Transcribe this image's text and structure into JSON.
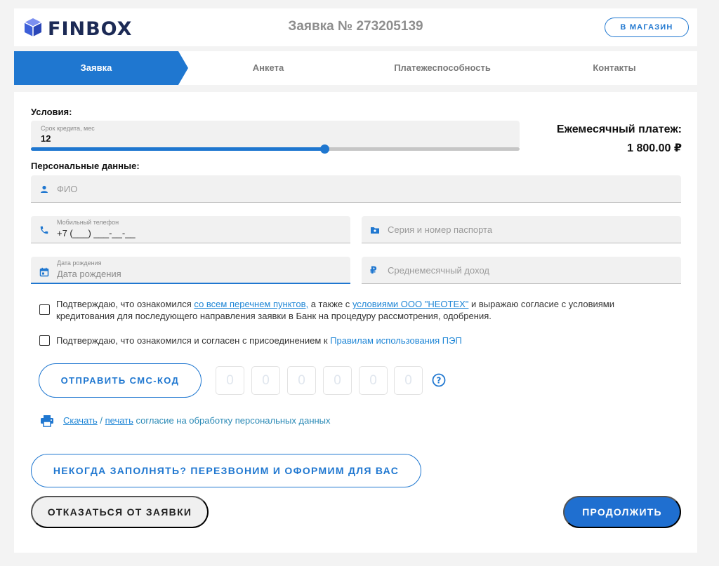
{
  "header": {
    "brand": "FINBOX",
    "order_title": "Заявка № 273205139",
    "shop_button": "В МАГАЗИН"
  },
  "steps": [
    {
      "label": "Заявка",
      "active": true
    },
    {
      "label": "Анкета",
      "active": false
    },
    {
      "label": "Платежеспособность",
      "active": false
    },
    {
      "label": "Контакты",
      "active": false
    }
  ],
  "conditions": {
    "title": "Условия:",
    "term_label": "Срок кредита, мес",
    "term_value": "12",
    "slider_level": 0.6
  },
  "payment": {
    "title": "Ежемесячный платеж:",
    "amount": "1 800.00 ₽"
  },
  "personal": {
    "title": "Персональные данные:",
    "fio_placeholder": "ФИО",
    "phone_label": "Мобильный телефон",
    "phone_value": "+7 (___) ___-__-__",
    "passport_placeholder": "Серия и номер паспорта",
    "dob_label": "Дата рождения",
    "dob_placeholder": "Дата рождения",
    "income_placeholder": "Среднемесячный доход"
  },
  "consent": {
    "c1_part1": "Подтверждаю, что ознакомился ",
    "c1_link1": "со всем перечнем пунктов,",
    "c1_part2": " а также с ",
    "c1_link2": "условиями ООО \"НЕОТЕХ\"",
    "c1_part3": " и выражаю согласие с условиями кредитования для последующего направления заявки в Банк на процедуру рассмотрения, одобрения.",
    "c2_part1": "Подтверждаю, что ознакомился и согласен с присоединением к ",
    "c2_link": "Правилам использования ПЭП"
  },
  "sms": {
    "button": "ОТПРАВИТЬ СМС-КОД",
    "digits": [
      "0",
      "0",
      "0",
      "0",
      "0",
      "0"
    ]
  },
  "personal_data_doc": {
    "download": "Скачать",
    "separator": "/",
    "print": "печать",
    "rest": " согласие на обработку персональных данных"
  },
  "actions": {
    "callback": "НЕКОГДА ЗАПОЛНЯТЬ? ПЕРЕЗВОНИМ И ОФОРМИМ ДЛЯ ВАС",
    "cancel": "ОТКАЗАТЬСЯ ОТ ЗАЯВКИ",
    "continue": "ПРОДОЛЖИТЬ"
  },
  "colors": {
    "accent": "#1f77d0",
    "link": "#1f86d6",
    "brand_dark": "#1c2a55"
  },
  "icons": [
    "finbox-cube-icon",
    "user-icon",
    "phone-icon",
    "passport-icon",
    "calendar-icon",
    "ruble-icon",
    "help-icon",
    "printer-icon"
  ]
}
